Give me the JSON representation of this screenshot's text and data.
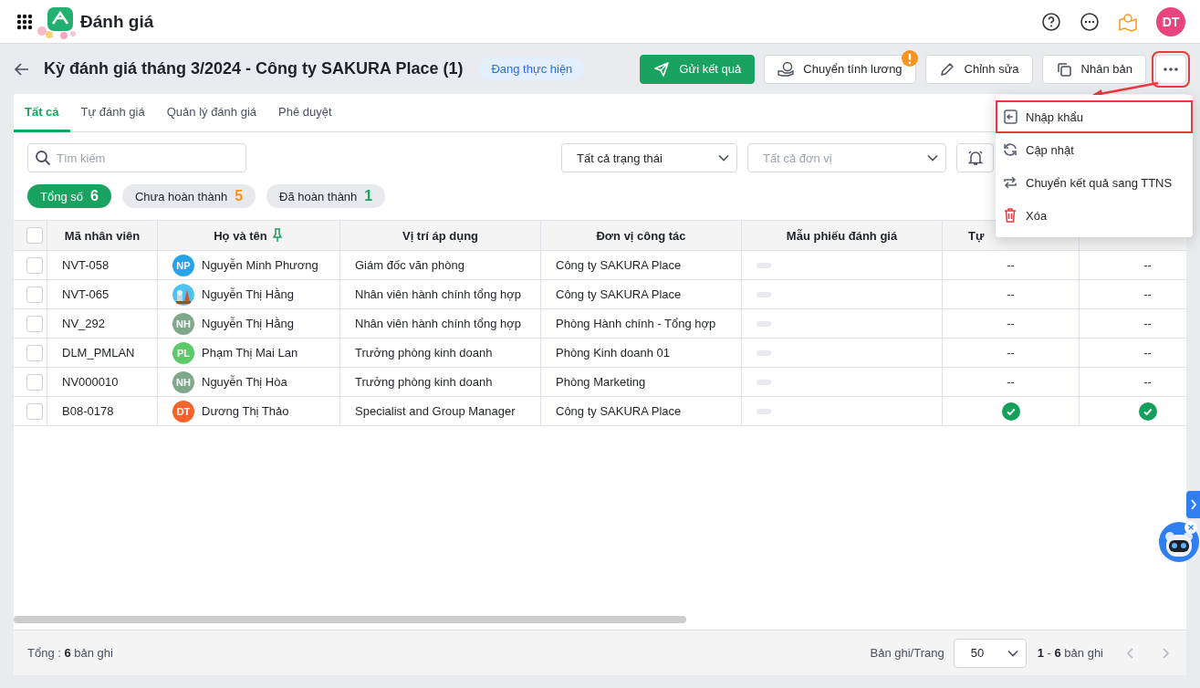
{
  "app": {
    "title": "Đánh giá"
  },
  "page": {
    "title": "Kỳ đánh giá tháng 3/2024 - Công ty SAKURA Place (1)",
    "status": "Đang thực hiện"
  },
  "actions": [
    {
      "kind": "send",
      "label": "Gửi kết quả",
      "primary": true,
      "alert": false
    },
    {
      "kind": "payroll",
      "label": "Chuyển tính lương",
      "primary": false,
      "alert": true
    },
    {
      "kind": "edit",
      "label": "Chỉnh sửa",
      "primary": false,
      "alert": false
    },
    {
      "kind": "copy",
      "label": "Nhân bản",
      "primary": false,
      "alert": false
    }
  ],
  "more_button": {
    "highlighted": true
  },
  "tabs": [
    {
      "label": "Tất cả",
      "selected": true
    },
    {
      "label": "Tự đánh giá",
      "selected": false
    },
    {
      "label": "Quản lý đánh giá",
      "selected": false
    },
    {
      "label": "Phê duyệt",
      "selected": false
    }
  ],
  "search": {
    "placeholder": "Tìm kiếm"
  },
  "filters": [
    {
      "value": "Tất cả trạng thái"
    },
    {
      "placeholder": "Tất cả đơn vị"
    }
  ],
  "chips": [
    {
      "label": "Tổng số",
      "count": "6",
      "selected": true,
      "color": "#ffffff"
    },
    {
      "label": "Chưa hoàn thành",
      "count": "5",
      "selected": false,
      "color": "#f7931e"
    },
    {
      "label": "Đã hoàn thành",
      "count": "1",
      "selected": false,
      "color": "#1aa260"
    }
  ],
  "table": {
    "all_checked": false,
    "columns": [
      "Mã nhân viên",
      "Họ và tên",
      "Vị trí áp dụng",
      "Đơn vị công tác",
      "Mẫu phiếu đánh giá",
      "Tự"
    ],
    "rows": [
      {
        "checked": false,
        "code": "NVT-058",
        "avatar": {
          "kind": "initials",
          "initials": "NP",
          "color": "#29a3e8"
        },
        "name": "Nguyễn Minh Phương",
        "position": "Giám đốc văn phòng",
        "unit": "Công ty SAKURA Place",
        "results": [
          {
            "kind": "dash",
            "text": "--"
          },
          {
            "kind": "dash",
            "text": "--"
          }
        ]
      },
      {
        "checked": false,
        "code": "NVT-065",
        "avatar": {
          "kind": "picture"
        },
        "name": "Nguyễn Thị Hằng",
        "position": "Nhân viên hành chính tổng hợp",
        "unit": "Công ty SAKURA Place",
        "results": [
          {
            "kind": "dash",
            "text": "--"
          },
          {
            "kind": "dash",
            "text": "--"
          }
        ]
      },
      {
        "checked": false,
        "code": "NV_292",
        "avatar": {
          "kind": "initials",
          "initials": "NH",
          "color": "#7fa88a"
        },
        "name": "Nguyễn Thị Hằng",
        "position": "Nhân viên hành chính tổng hợp",
        "unit": "Phòng Hành chính - Tổng hợp",
        "results": [
          {
            "kind": "dash",
            "text": "--"
          },
          {
            "kind": "dash",
            "text": "--"
          }
        ]
      },
      {
        "checked": false,
        "code": "DLM_PMLAN",
        "avatar": {
          "kind": "initials",
          "initials": "PL",
          "color": "#5cc96b"
        },
        "name": "Phạm Thị Mai Lan",
        "position": "Trưởng phòng kinh doanh",
        "unit": "Phòng Kinh doanh 01",
        "results": [
          {
            "kind": "dash",
            "text": "--"
          },
          {
            "kind": "dash",
            "text": "--"
          }
        ]
      },
      {
        "checked": false,
        "code": "NV000010",
        "avatar": {
          "kind": "initials",
          "initials": "NH",
          "color": "#7fa88a"
        },
        "name": "Nguyễn Thị Hòa",
        "position": "Trưởng phòng kinh doanh",
        "unit": "Phòng Marketing",
        "results": [
          {
            "kind": "dash",
            "text": "--"
          },
          {
            "kind": "dash",
            "text": "--"
          }
        ]
      },
      {
        "checked": false,
        "code": "B08-0178",
        "avatar": {
          "kind": "initials",
          "initials": "DT",
          "color": "#f4642c"
        },
        "name": "Dương Thị Thảo",
        "position": "Specialist and Group Manager",
        "unit": "Công ty SAKURA Place",
        "results": [
          {
            "kind": "check"
          },
          {
            "kind": "check"
          }
        ]
      }
    ]
  },
  "footer": {
    "total": "Tổng : **6** bản ghi",
    "per_page_label": "Bản ghi/Trang",
    "per_page": "50",
    "range": "**1** - **6** bản ghi"
  },
  "menu": [
    {
      "kind": "import",
      "label": "Nhập khẩu",
      "highlighted": true
    },
    {
      "kind": "refresh",
      "label": "Cập nhật",
      "highlighted": false
    },
    {
      "kind": "transfer",
      "label": "Chuyển kết quả sang TTNS",
      "highlighted": false
    },
    {
      "kind": "delete",
      "label": "Xóa",
      "highlighted": false
    }
  ],
  "user": {
    "initials": "DT"
  }
}
